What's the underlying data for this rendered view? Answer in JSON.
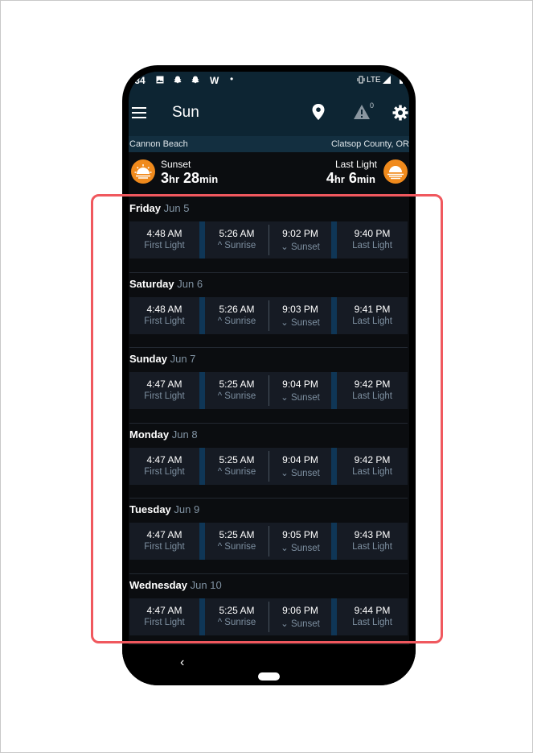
{
  "status_bar": {
    "time": ".34",
    "w": "W",
    "dot": "•",
    "network": "LTE"
  },
  "app_bar": {
    "title": "Sun",
    "alert_count": "0",
    "icons": [
      "menu-icon",
      "location-pin-icon",
      "warning-icon",
      "gear-icon"
    ]
  },
  "location": {
    "city": "Cannon Beach",
    "county": "Clatsop County, OR"
  },
  "summary": {
    "left": {
      "label": "Sunset",
      "hours": "3",
      "hr_unit": "hr",
      "minutes": "28",
      "min_unit": "min"
    },
    "right": {
      "label": "Last Light",
      "hours": "4",
      "hr_unit": "hr",
      "minutes": "6",
      "min_unit": "min"
    }
  },
  "days": [
    {
      "weekday": "Friday",
      "date": "Jun 5",
      "first_light": "4:48 AM",
      "sunrise": "5:26 AM",
      "sunset": "9:02 PM",
      "last_light": "9:40 PM"
    },
    {
      "weekday": "Saturday",
      "date": "Jun 6",
      "first_light": "4:48 AM",
      "sunrise": "5:26 AM",
      "sunset": "9:03 PM",
      "last_light": "9:41 PM"
    },
    {
      "weekday": "Sunday",
      "date": "Jun 7",
      "first_light": "4:47 AM",
      "sunrise": "5:25 AM",
      "sunset": "9:04 PM",
      "last_light": "9:42 PM"
    },
    {
      "weekday": "Monday",
      "date": "Jun 8",
      "first_light": "4:47 AM",
      "sunrise": "5:25 AM",
      "sunset": "9:04 PM",
      "last_light": "9:42 PM"
    },
    {
      "weekday": "Tuesday",
      "date": "Jun 9",
      "first_light": "4:47 AM",
      "sunrise": "5:25 AM",
      "sunset": "9:05 PM",
      "last_light": "9:43 PM"
    },
    {
      "weekday": "Wednesday",
      "date": "Jun 10",
      "first_light": "4:47 AM",
      "sunrise": "5:25 AM",
      "sunset": "9:06 PM",
      "last_light": "9:44 PM"
    }
  ],
  "labels": {
    "first_light": "First Light",
    "sunrise": "^ Sunrise",
    "sunset": "⌄ Sunset",
    "last_light": "Last Light"
  },
  "nav": {
    "back": "‹"
  },
  "colors": {
    "accent_orange": "#f08a1c",
    "header_bg": "#0d2533",
    "highlight": "#f0585e"
  }
}
